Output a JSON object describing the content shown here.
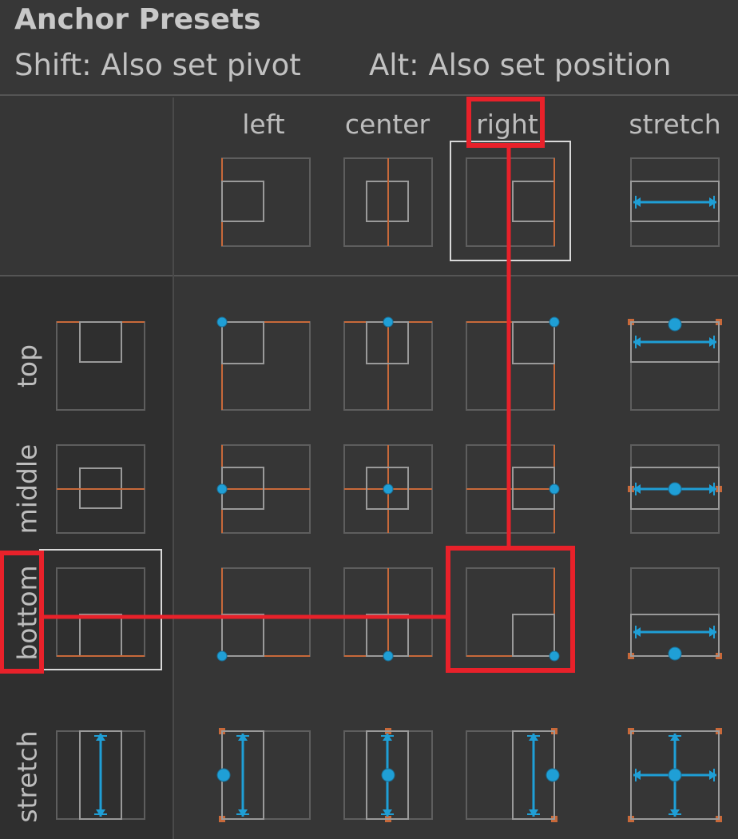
{
  "header": {
    "title": "Anchor Presets",
    "shift_hint": "Shift: Also set pivot",
    "alt_hint": "Alt: Also set position"
  },
  "columns": [
    "left",
    "center",
    "right",
    "stretch"
  ],
  "rows": [
    "top",
    "middle",
    "bottom",
    "stretch"
  ],
  "selected": {
    "column": "right",
    "row": "bottom"
  },
  "colors": {
    "background": "#363636",
    "sidebar": "#2f2f2f",
    "anchor_line": "#c8693a",
    "pivot_dot": "#1f9fd6",
    "frame": "#5e5e5e",
    "child_rect": "#9a9a9a",
    "highlight_outline": "#d9d9d9",
    "annotation_red": "#e8212a"
  },
  "icons": {
    "anchor_preset_cell": "anchor-preset-icon",
    "pivot": "pivot-dot-icon",
    "stretch_arrow": "stretch-arrow-icon"
  }
}
